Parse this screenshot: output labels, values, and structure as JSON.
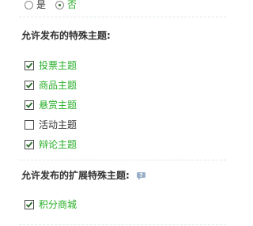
{
  "radio_group": {
    "options": [
      {
        "label": "是",
        "selected": false
      },
      {
        "label": "否",
        "selected": true
      }
    ]
  },
  "special_topics": {
    "title": "允许发布的特殊主题:",
    "items": [
      {
        "label": "投票主题",
        "checked": true
      },
      {
        "label": "商品主题",
        "checked": true
      },
      {
        "label": "悬赏主题",
        "checked": true
      },
      {
        "label": "活动主题",
        "checked": false
      },
      {
        "label": "辩论主题",
        "checked": true
      }
    ]
  },
  "extended_topics": {
    "title": "允许发布的扩展特殊主题:",
    "help_icon": "question-bubble-icon",
    "items": [
      {
        "label": "积分商城",
        "checked": true
      }
    ]
  },
  "colors": {
    "checked_label": "#27ae27",
    "unchecked_label": "#333333",
    "divider": "#dfe7ee",
    "help_icon": "#9bb0c8"
  }
}
